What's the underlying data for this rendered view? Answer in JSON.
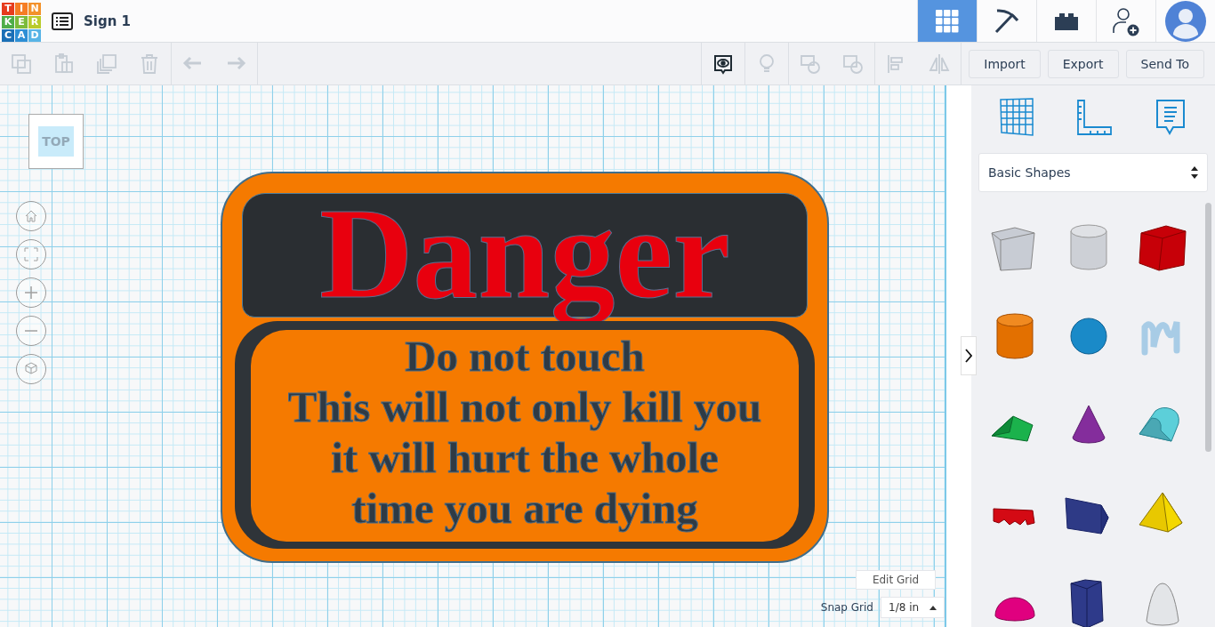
{
  "header": {
    "logo": [
      {
        "letter": "T",
        "color": "#e63c1e"
      },
      {
        "letter": "I",
        "color": "#f57d24"
      },
      {
        "letter": "N",
        "color": "#f3922b"
      },
      {
        "letter": "K",
        "color": "#4fae48"
      },
      {
        "letter": "E",
        "color": "#7cbb3b"
      },
      {
        "letter": "R",
        "color": "#b9cb2d"
      },
      {
        "letter": "C",
        "color": "#1a6fb6"
      },
      {
        "letter": "A",
        "color": "#2d8fd5"
      },
      {
        "letter": "D",
        "color": "#58b4e6"
      }
    ],
    "title": "Sign 1",
    "modes": [
      {
        "kind": "grid",
        "selected": true
      },
      {
        "kind": "pickaxe",
        "selected": false
      },
      {
        "kind": "brick",
        "selected": false
      },
      {
        "kind": "invite",
        "selected": false
      },
      {
        "kind": "avatar",
        "selected": false
      }
    ]
  },
  "toolbar": {
    "buttons": [
      "Import",
      "Export",
      "Send To"
    ]
  },
  "view_cube": "TOP",
  "sign": {
    "heading": "Danger",
    "lines": [
      "Do not touch",
      "This will not only kill you",
      "it will hurt the whole",
      "time you are dying"
    ]
  },
  "grid": {
    "edit": "Edit Grid",
    "snap_label": "Snap Grid",
    "snap_value": "1/8 in"
  },
  "panel": {
    "library": "Basic Shapes",
    "shapes": [
      {
        "kind": "box-hole"
      },
      {
        "kind": "cylinder-hole"
      },
      {
        "kind": "box"
      },
      {
        "kind": "cylinder"
      },
      {
        "kind": "sphere"
      },
      {
        "kind": "scribble"
      },
      {
        "kind": "roof"
      },
      {
        "kind": "cone"
      },
      {
        "kind": "round-roof"
      },
      {
        "kind": "text"
      },
      {
        "kind": "polygon"
      },
      {
        "kind": "pyramid"
      },
      {
        "kind": "half-sphere"
      },
      {
        "kind": "hexagon"
      },
      {
        "kind": "paraboloid"
      }
    ]
  }
}
